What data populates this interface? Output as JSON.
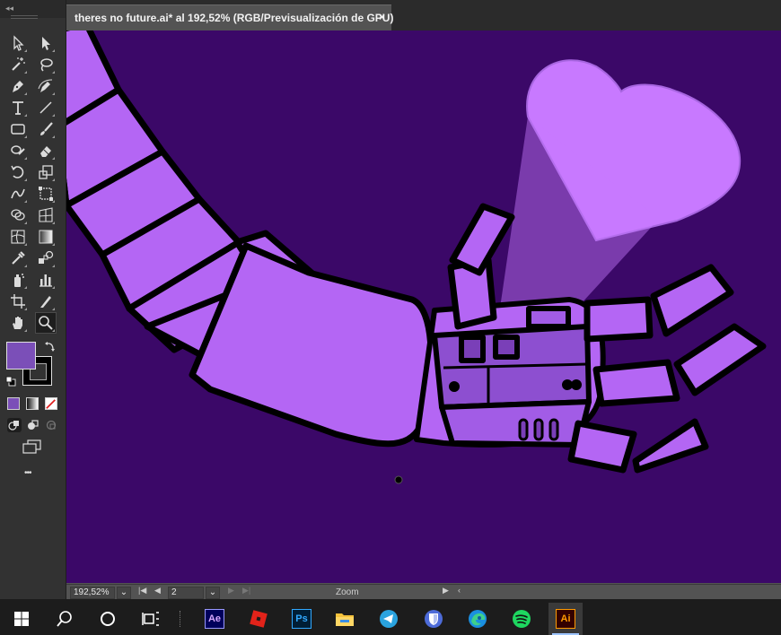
{
  "document_tab": {
    "title": "theres no future.ai* al 192,52% (RGB/Previsualización de GPU)",
    "close_glyph": "×"
  },
  "toolbar": {
    "tools": [
      "selection-tool",
      "direct-selection-tool",
      "magic-wand-tool",
      "lasso-tool",
      "pen-tool",
      "curvature-tool",
      "type-tool",
      "line-segment-tool",
      "rectangle-tool",
      "paintbrush-tool",
      "shaper-tool",
      "eraser-tool",
      "rotate-tool",
      "scale-tool",
      "width-tool",
      "free-transform-tool",
      "shape-builder-tool",
      "perspective-grid-tool",
      "mesh-tool",
      "gradient-tool",
      "eyedropper-tool",
      "blend-tool",
      "symbol-sprayer-tool",
      "column-graph-tool",
      "artboard-tool",
      "slice-tool",
      "hand-tool",
      "zoom-tool"
    ],
    "selected_tool": "zoom-tool",
    "fill_color": "#7b4fb8",
    "stroke_color": "#000000",
    "more_glyph": "•••"
  },
  "status_bar": {
    "zoom_value": "192,52%",
    "artboard_value": "2",
    "status_label": "Zoom"
  },
  "canvas": {
    "background": "#3b0868",
    "main_color": "#b466f4",
    "light_color": "#c879ff",
    "dark_color": "#7a3fb8",
    "outline_color": "#000000"
  },
  "taskbar": {
    "apps": [
      "windows-start",
      "search",
      "cortana",
      "task-view",
      "after-effects",
      "roblox",
      "photoshop",
      "file-explorer",
      "telegram",
      "bitwarden",
      "edge",
      "spotify",
      "illustrator"
    ],
    "after_effects_label": "Ae",
    "photoshop_label": "Ps",
    "illustrator_label": "Ai"
  }
}
